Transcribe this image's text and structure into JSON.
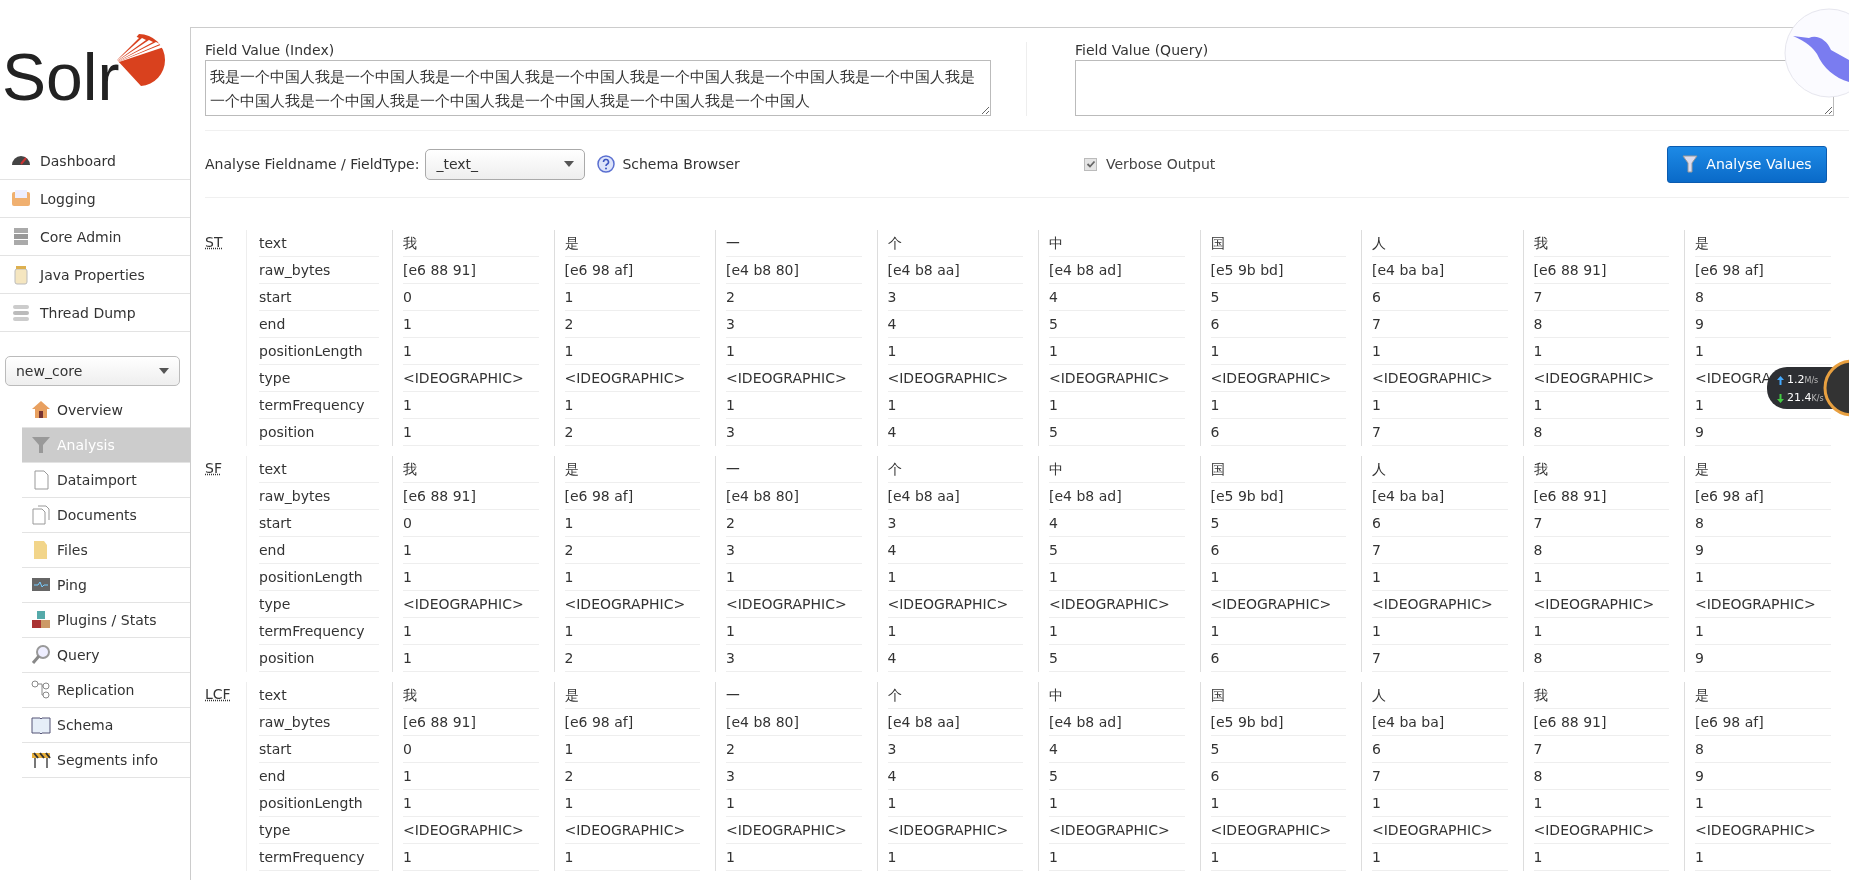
{
  "logo": {
    "text": "Solr"
  },
  "nav": [
    {
      "label": "Dashboard"
    },
    {
      "label": "Logging"
    },
    {
      "label": "Core Admin"
    },
    {
      "label": "Java Properties"
    },
    {
      "label": "Thread Dump"
    }
  ],
  "core_selector": {
    "value": "new_core"
  },
  "core_nav": [
    {
      "label": "Overview",
      "selected": false
    },
    {
      "label": "Analysis",
      "selected": true
    },
    {
      "label": "Dataimport",
      "selected": false
    },
    {
      "label": "Documents",
      "selected": false
    },
    {
      "label": "Files",
      "selected": false
    },
    {
      "label": "Ping",
      "selected": false
    },
    {
      "label": "Plugins / Stats",
      "selected": false
    },
    {
      "label": "Query",
      "selected": false
    },
    {
      "label": "Replication",
      "selected": false
    },
    {
      "label": "Schema",
      "selected": false
    },
    {
      "label": "Segments info",
      "selected": false
    }
  ],
  "form": {
    "index_label": "Field Value (Index)",
    "index_value": "我是一个中国人我是一个中国人我是一个中国人我是一个中国人我是一个中国人我是一个中国人我是一个中国人我是一个中国人我是一个中国人我是一个中国人我是一个中国人我是一个中国人我是一个中国人",
    "query_label": "Field Value (Query)",
    "fieldtype_label": "Analyse Fieldname / FieldType:",
    "fieldtype_value": "_text_",
    "help_link": "Schema Browser",
    "verbose": {
      "label": "Verbose Output",
      "checked": true
    },
    "submit": "Analyse Values"
  },
  "stages": [
    {
      "abbr": "ST",
      "rows": [
        {
          "name": "text",
          "values": [
            "我",
            "是",
            "一",
            "个",
            "中",
            "国",
            "人",
            "我",
            "是"
          ]
        },
        {
          "name": "raw_bytes",
          "values": [
            "[e6 88 91]",
            "[e6 98 af]",
            "[e4 b8 80]",
            "[e4 b8 aa]",
            "[e4 b8 ad]",
            "[e5 9b bd]",
            "[e4 ba ba]",
            "[e6 88 91]",
            "[e6 98 af]"
          ]
        },
        {
          "name": "start",
          "values": [
            "0",
            "1",
            "2",
            "3",
            "4",
            "5",
            "6",
            "7",
            "8"
          ]
        },
        {
          "name": "end",
          "values": [
            "1",
            "2",
            "3",
            "4",
            "5",
            "6",
            "7",
            "8",
            "9"
          ]
        },
        {
          "name": "positionLength",
          "values": [
            "1",
            "1",
            "1",
            "1",
            "1",
            "1",
            "1",
            "1",
            "1"
          ]
        },
        {
          "name": "type",
          "values": [
            "<IDEOGRAPHIC>",
            "<IDEOGRAPHIC>",
            "<IDEOGRAPHIC>",
            "<IDEOGRAPHIC>",
            "<IDEOGRAPHIC>",
            "<IDEOGRAPHIC>",
            "<IDEOGRAPHIC>",
            "<IDEOGRAPHIC>",
            "<IDEOGRA"
          ]
        },
        {
          "name": "termFrequency",
          "values": [
            "1",
            "1",
            "1",
            "1",
            "1",
            "1",
            "1",
            "1",
            "1"
          ]
        },
        {
          "name": "position",
          "values": [
            "1",
            "2",
            "3",
            "4",
            "5",
            "6",
            "7",
            "8",
            "9"
          ]
        }
      ]
    },
    {
      "abbr": "SF",
      "rows": [
        {
          "name": "text",
          "values": [
            "我",
            "是",
            "一",
            "个",
            "中",
            "国",
            "人",
            "我",
            "是"
          ]
        },
        {
          "name": "raw_bytes",
          "values": [
            "[e6 88 91]",
            "[e6 98 af]",
            "[e4 b8 80]",
            "[e4 b8 aa]",
            "[e4 b8 ad]",
            "[e5 9b bd]",
            "[e4 ba ba]",
            "[e6 88 91]",
            "[e6 98 af]"
          ]
        },
        {
          "name": "start",
          "values": [
            "0",
            "1",
            "2",
            "3",
            "4",
            "5",
            "6",
            "7",
            "8"
          ]
        },
        {
          "name": "end",
          "values": [
            "1",
            "2",
            "3",
            "4",
            "5",
            "6",
            "7",
            "8",
            "9"
          ]
        },
        {
          "name": "positionLength",
          "values": [
            "1",
            "1",
            "1",
            "1",
            "1",
            "1",
            "1",
            "1",
            "1"
          ]
        },
        {
          "name": "type",
          "values": [
            "<IDEOGRAPHIC>",
            "<IDEOGRAPHIC>",
            "<IDEOGRAPHIC>",
            "<IDEOGRAPHIC>",
            "<IDEOGRAPHIC>",
            "<IDEOGRAPHIC>",
            "<IDEOGRAPHIC>",
            "<IDEOGRAPHIC>",
            "<IDEOGRAPHIC>"
          ]
        },
        {
          "name": "termFrequency",
          "values": [
            "1",
            "1",
            "1",
            "1",
            "1",
            "1",
            "1",
            "1",
            "1"
          ]
        },
        {
          "name": "position",
          "values": [
            "1",
            "2",
            "3",
            "4",
            "5",
            "6",
            "7",
            "8",
            "9"
          ]
        }
      ]
    },
    {
      "abbr": "LCF",
      "rows": [
        {
          "name": "text",
          "values": [
            "我",
            "是",
            "一",
            "个",
            "中",
            "国",
            "人",
            "我",
            "是"
          ]
        },
        {
          "name": "raw_bytes",
          "values": [
            "[e6 88 91]",
            "[e6 98 af]",
            "[e4 b8 80]",
            "[e4 b8 aa]",
            "[e4 b8 ad]",
            "[e5 9b bd]",
            "[e4 ba ba]",
            "[e6 88 91]",
            "[e6 98 af]"
          ]
        },
        {
          "name": "start",
          "values": [
            "0",
            "1",
            "2",
            "3",
            "4",
            "5",
            "6",
            "7",
            "8"
          ]
        },
        {
          "name": "end",
          "values": [
            "1",
            "2",
            "3",
            "4",
            "5",
            "6",
            "7",
            "8",
            "9"
          ]
        },
        {
          "name": "positionLength",
          "values": [
            "1",
            "1",
            "1",
            "1",
            "1",
            "1",
            "1",
            "1",
            "1"
          ]
        },
        {
          "name": "type",
          "values": [
            "<IDEOGRAPHIC>",
            "<IDEOGRAPHIC>",
            "<IDEOGRAPHIC>",
            "<IDEOGRAPHIC>",
            "<IDEOGRAPHIC>",
            "<IDEOGRAPHIC>",
            "<IDEOGRAPHIC>",
            "<IDEOGRAPHIC>",
            "<IDEOGRAPHIC>"
          ]
        },
        {
          "name": "termFrequency",
          "values": [
            "1",
            "1",
            "1",
            "1",
            "1",
            "1",
            "1",
            "1",
            "1"
          ]
        }
      ]
    }
  ],
  "speed_widget": {
    "upload": {
      "value": "1.2",
      "unit": "M/s"
    },
    "download": {
      "value": "21.4",
      "unit": "K/s"
    }
  }
}
